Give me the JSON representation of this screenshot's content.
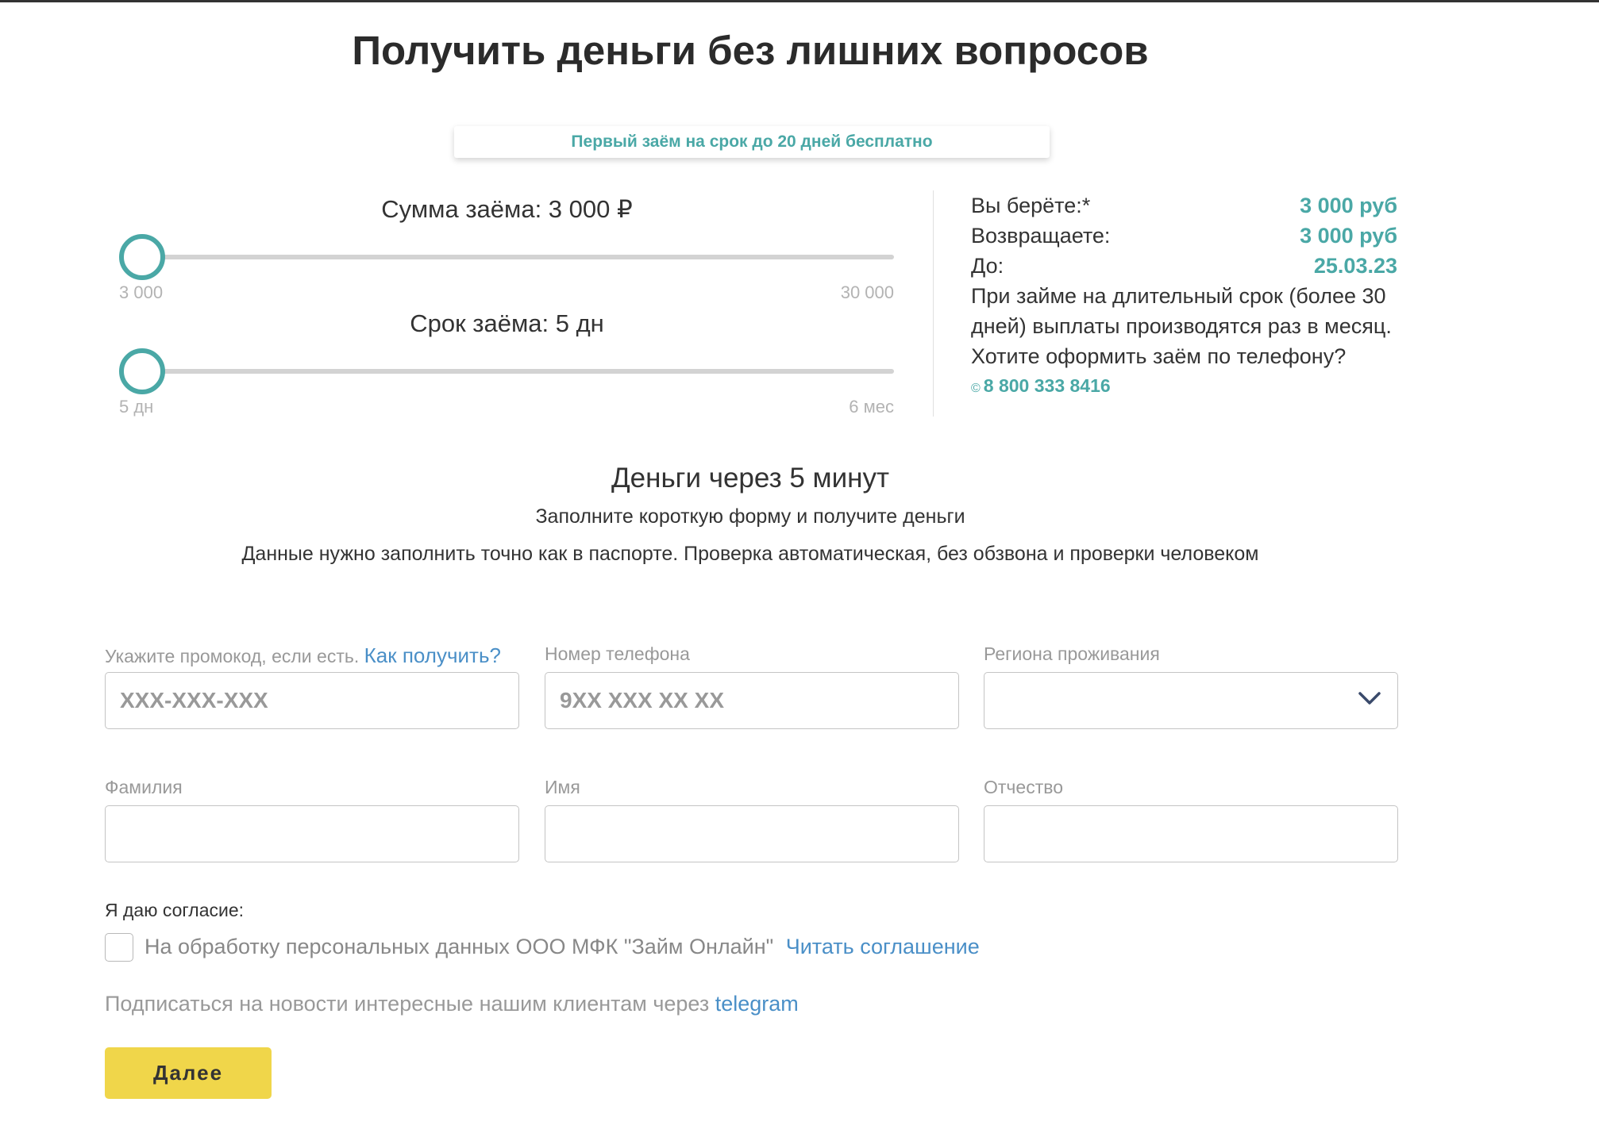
{
  "page": {
    "title": "Получить деньги без лишних вопросов",
    "promo_banner": "Первый заём на срок до 20 дней бесплатно"
  },
  "sliders": {
    "amount": {
      "label": "Сумма заёма: 3 000 ₽",
      "min_label": "3 000",
      "max_label": "30 000",
      "value": 3000,
      "min": 3000,
      "max": 30000
    },
    "term": {
      "label": "Срок заёма: 5 дн",
      "min_label": "5 дн",
      "max_label": "6 мес",
      "value_fraction": 0
    }
  },
  "summary": {
    "take_label": "Вы берёте:*",
    "take_value": "3 000 руб",
    "return_label": "Возвращаете:",
    "return_value": "3 000 руб",
    "until_label": "До:",
    "until_value": "25.03.23",
    "note": "При займе на длительный срок (более 30 дней) выплаты производятся раз в месяц.",
    "phone_question": "Хотите оформить заём по телефону?",
    "phone_icon": "©",
    "phone_number": "8 800 333 8416"
  },
  "section": {
    "title": "Деньги через 5 минут",
    "subtitle": "Заполните короткую форму и получите деньги",
    "subtitle2": "Данные нужно заполнить точно как в паспорте. Проверка автоматическая, без обзвона и проверки человеком"
  },
  "form": {
    "promo_label": "Укажите промокод, если есть.",
    "promo_link": "Как получить?",
    "promo_placeholder": "XXX-XXX-XXX",
    "phone_label": "Номер телефона",
    "phone_placeholder": "9XX XXX XX XX",
    "region_label": "Региона проживания",
    "surname_label": "Фамилия",
    "name_label": "Имя",
    "patronymic_label": "Отчество"
  },
  "consent": {
    "title": "Я даю согласие:",
    "text": "На обработку персональных данных ООО МФК \"Займ Онлайн\"",
    "link": "Читать соглашение",
    "checked": false
  },
  "subscribe": {
    "text": "Подписаться на новости интересные нашим клиентам через",
    "link": "telegram"
  },
  "buttons": {
    "next": "Далее"
  },
  "colors": {
    "accent": "#4aa8a6",
    "link": "#4a8fc7",
    "button": "#f0d64a"
  },
  "icons": {
    "region_dropdown": "chevron-down-icon",
    "phone": "phone-icon"
  }
}
